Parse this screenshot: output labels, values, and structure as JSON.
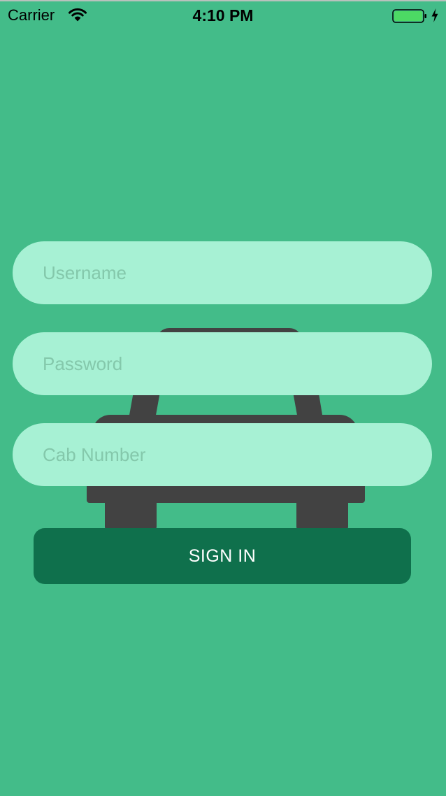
{
  "status_bar": {
    "carrier": "Carrier",
    "time": "4:10 PM",
    "battery_color": "#4cd964"
  },
  "background": {
    "color": "#43bc89",
    "icon": "car-icon"
  },
  "form": {
    "username": {
      "placeholder": "Username",
      "value": ""
    },
    "password": {
      "placeholder": "Password",
      "value": ""
    },
    "cab_number": {
      "placeholder": "Cab Number",
      "value": ""
    },
    "sign_in_label": "SIGN IN",
    "field_color": "#a7f1d4",
    "button_color": "#0f704c"
  }
}
